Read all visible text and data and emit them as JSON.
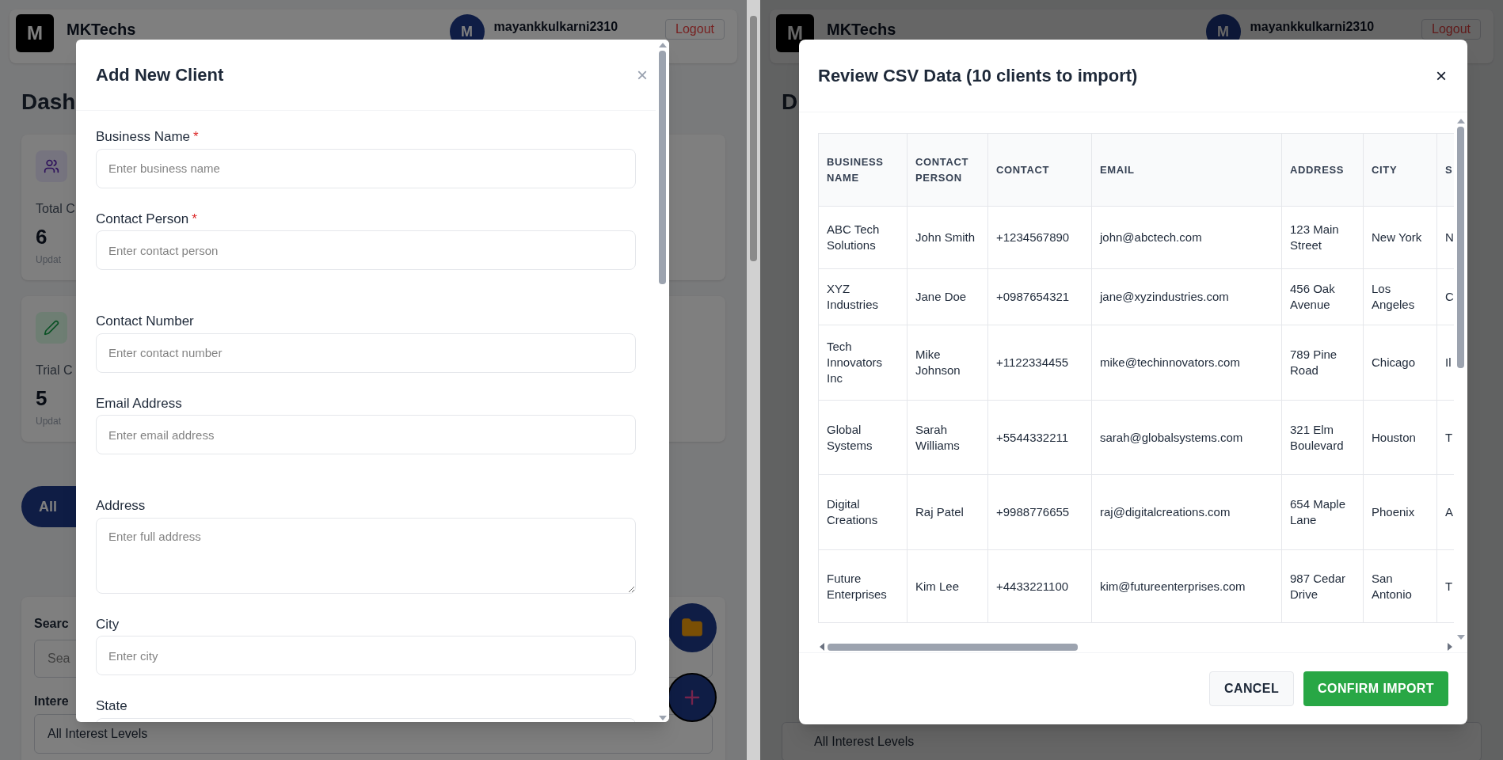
{
  "left_screen": {
    "header": {
      "logo": "M",
      "brand": "MKTechs",
      "avatar": "M",
      "username": "mayankkulkarni2310",
      "logout": "Logout"
    },
    "page_title": "Dash",
    "stat_cards": [
      {
        "kind": "people",
        "label": "Total C",
        "value": "6",
        "note": "Updat"
      },
      {
        "kind": "pen",
        "label": "Trial C",
        "value": "5",
        "note": "Updat"
      }
    ],
    "filter_pill": "All",
    "search_panel": {
      "search_label": "Searc",
      "search_placeholder": "Sea",
      "interest_label": "Intere",
      "interest_value": "All Interest Levels"
    },
    "modal": {
      "title": "Add New Client",
      "close": "×",
      "fields": [
        {
          "kind": "input",
          "label": "Business Name",
          "required_mark": "*",
          "placeholder": "Enter business name"
        },
        {
          "kind": "input",
          "label": "Contact Person",
          "required_mark": "*",
          "placeholder": "Enter contact person"
        },
        {
          "kind": "input",
          "label": "Contact Number",
          "placeholder": "Enter contact number"
        },
        {
          "kind": "input",
          "label": "Email Address",
          "placeholder": "Enter email address"
        },
        {
          "kind": "textarea",
          "label": "Address",
          "placeholder": "Enter full address"
        },
        {
          "kind": "input",
          "label": "City",
          "placeholder": "Enter city"
        },
        {
          "kind": "input",
          "label": "State"
        }
      ]
    }
  },
  "right_screen": {
    "header": {
      "logo": "M",
      "brand": "MKTechs",
      "avatar": "M",
      "username": "mayankkulkarni2310",
      "logout": "Logout"
    },
    "page_title": "D",
    "interest_value": "All Interest Levels",
    "modal": {
      "title": "Review CSV Data (10 clients to import)",
      "close": "×",
      "table": {
        "columns": [
          "BUSINESS NAME",
          "CONTACT PERSON",
          "CONTACT",
          "EMAIL",
          "ADDRESS",
          "CITY",
          "S"
        ],
        "rows": [
          [
            "ABC Tech Solutions",
            "John Smith",
            "+1234567890",
            "john@abctech.com",
            "123 Main Street",
            "New York",
            "N"
          ],
          [
            "XYZ Industries",
            "Jane Doe",
            "+0987654321",
            "jane@xyzindustries.com",
            "456 Oak Avenue",
            "Los Angeles",
            "C"
          ],
          [
            "Tech Innovators Inc",
            "Mike Johnson",
            "+1122334455",
            "mike@techinnovators.com",
            "789 Pine Road",
            "Chicago",
            "Il"
          ],
          [
            "Global Systems",
            "Sarah Williams",
            "+5544332211",
            "sarah@globalsystems.com",
            "321 Elm Boulevard",
            "Houston",
            "T"
          ],
          [
            "Digital Creations",
            "Raj Patel",
            "+9988776655",
            "raj@digitalcreations.com",
            "654 Maple Lane",
            "Phoenix",
            "A"
          ],
          [
            "Future Enterprises",
            "Kim Lee",
            "+4433221100",
            "kim@futureenterprises.com",
            "987 Cedar Drive",
            "San Antonio",
            "T"
          ]
        ]
      },
      "buttons": [
        {
          "kind": "secondary",
          "label": "CANCEL"
        },
        {
          "kind": "primary",
          "label": "CONFIRM IMPORT"
        }
      ]
    }
  }
}
